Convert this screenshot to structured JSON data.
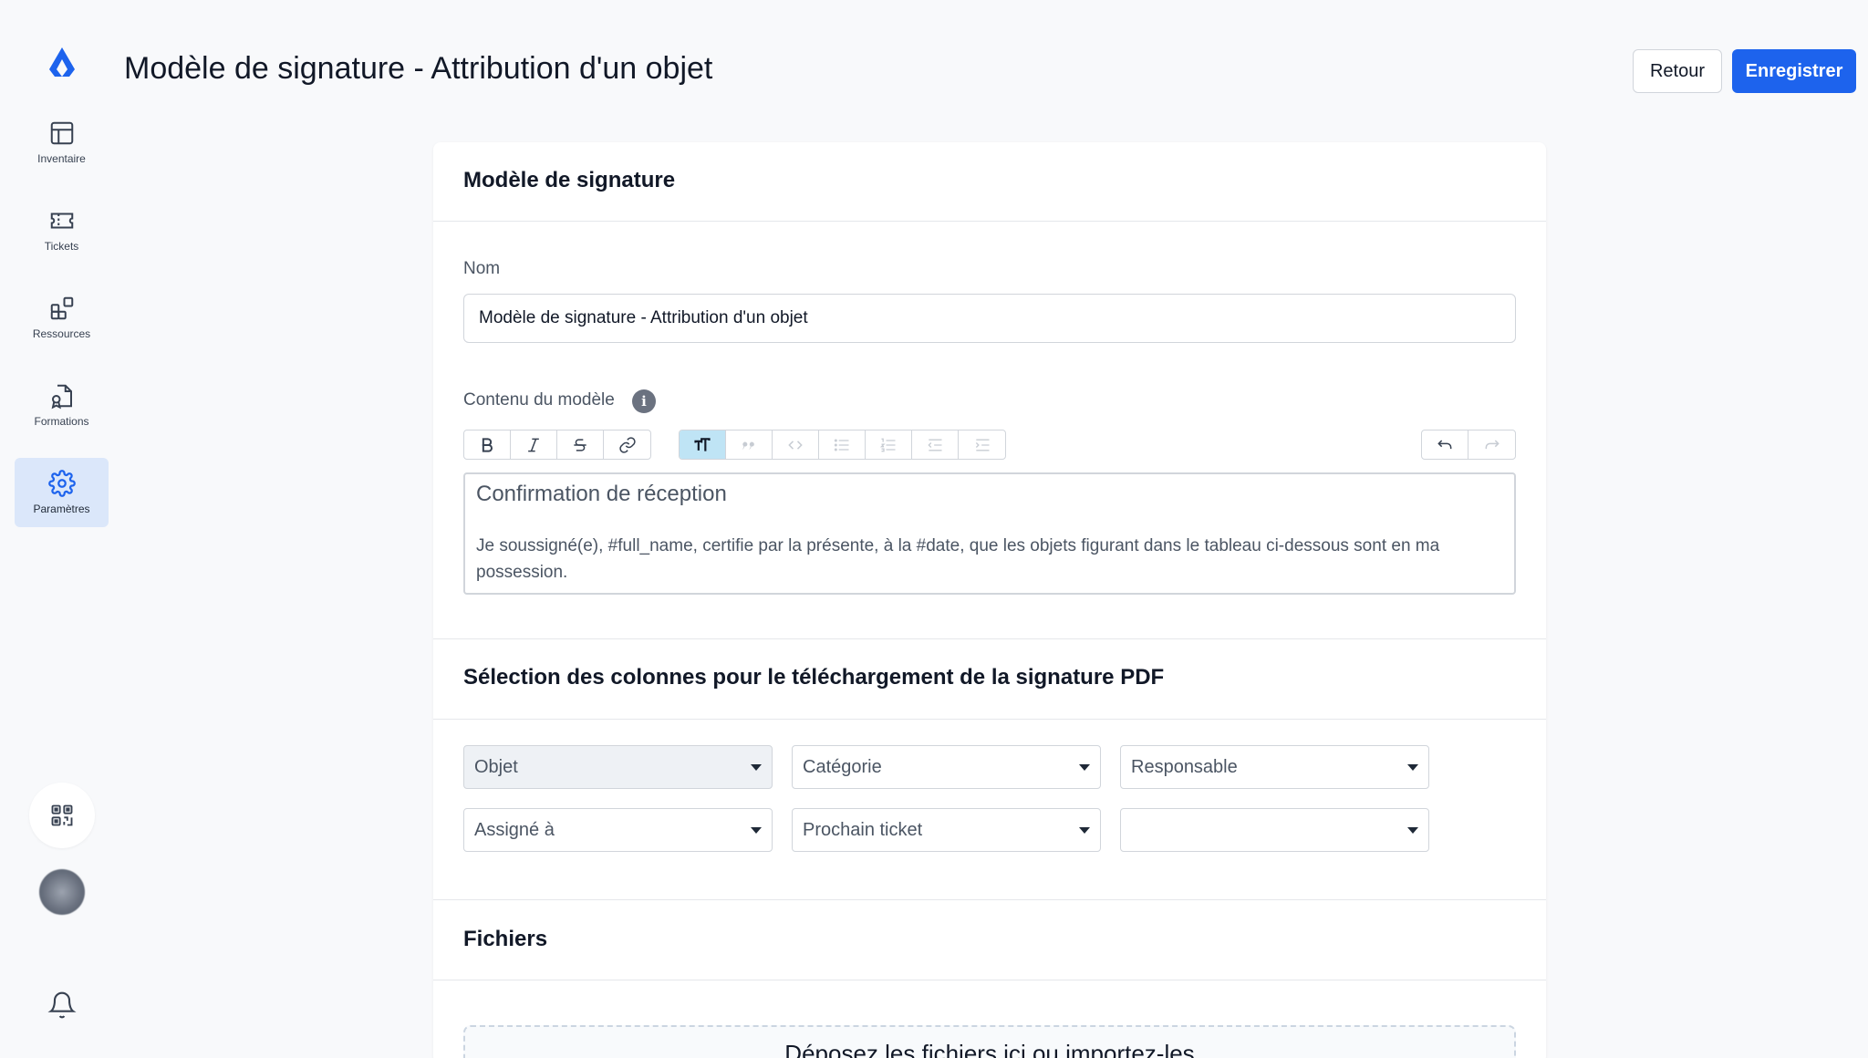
{
  "sidebar": {
    "items": [
      {
        "label": "Inventaire",
        "icon": "table-icon"
      },
      {
        "label": "Tickets",
        "icon": "ticket-icon"
      },
      {
        "label": "Ressources",
        "icon": "resources-icon"
      },
      {
        "label": "Formations",
        "icon": "certificate-icon"
      },
      {
        "label": "Paramètres",
        "icon": "gear-icon"
      }
    ],
    "active_index": 4,
    "accent": "#1d63ed"
  },
  "header": {
    "title": "Modèle de signature - Attribution d'un objet",
    "back_label": "Retour",
    "save_label": "Enregistrer"
  },
  "template_section": {
    "title": "Modèle de signature",
    "name_label": "Nom",
    "name_value": "Modèle de signature - Attribution d'un objet",
    "content_label": "Contenu du modèle",
    "editor_heading": "Confirmation de réception",
    "editor_body": "Je soussigné(e), #full_name, certifie par la présente, à la #date, que les objets figurant dans le tableau ci-dessous sont en ma possession."
  },
  "columns_section": {
    "title": "Sélection des colonnes pour le téléchargement de la signature PDF",
    "selects": [
      "Objet",
      "Catégorie",
      "Responsable",
      "Assigné à",
      "Prochain ticket",
      ""
    ]
  },
  "files_section": {
    "title": "Fichiers",
    "dropzone_text": "Déposez les fichiers ici ou importez-les"
  }
}
